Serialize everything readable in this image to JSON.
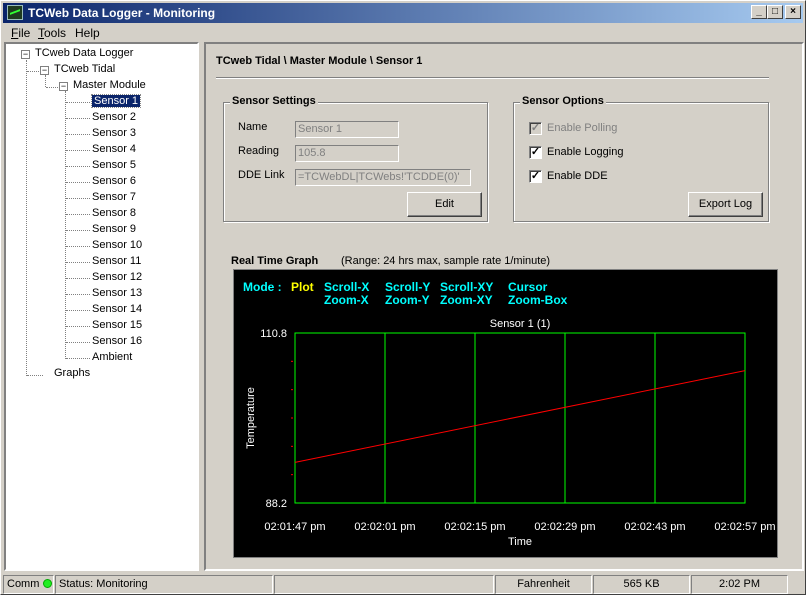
{
  "window": {
    "title": "TCWeb Data Logger - Monitoring",
    "min_label": "_",
    "max_label": "□",
    "close_label": "×"
  },
  "menu": {
    "file_first": "F",
    "file_rest": "ile",
    "tools_first": "T",
    "tools_rest": "ools",
    "help": "Help"
  },
  "tree": {
    "root": "TCweb Data Logger",
    "device": "TCweb Tidal",
    "module": "Master Module",
    "sensors": [
      "Sensor 1",
      "Sensor 2",
      "Sensor 3",
      "Sensor 4",
      "Sensor 5",
      "Sensor 6",
      "Sensor 7",
      "Sensor 8",
      "Sensor 9",
      "Sensor 10",
      "Sensor 11",
      "Sensor 12",
      "Sensor 13",
      "Sensor 14",
      "Sensor 15",
      "Sensor 16",
      "Ambient"
    ],
    "graphs": "Graphs",
    "expander_label": "−"
  },
  "main": {
    "breadcrumb": "TCweb Tidal \\ Master Module \\ Sensor 1",
    "settings": {
      "title": "Sensor Settings",
      "name_label": "Name",
      "name_value": "Sensor 1",
      "reading_label": "Reading",
      "reading_value": "105.8",
      "dde_label": "DDE Link",
      "dde_value": "=TCWebDL|TCWebs!'TCDDE(0)'",
      "edit_button": "Edit"
    },
    "options": {
      "title": "Sensor Options",
      "polling_label": "Enable Polling",
      "polling_checked": true,
      "polling_disabled": true,
      "logging_label": "Enable Logging",
      "logging_checked": true,
      "dde_label": "Enable DDE",
      "dde_checked": true,
      "check_mark": "✓",
      "export_button": "Export Log"
    },
    "graph": {
      "title": "Real Time Graph",
      "range": "(Range: 24 hrs max, sample rate 1/minute)",
      "mode_label": "Mode :",
      "modes": [
        {
          "top": "Plot",
          "bottom": "",
          "color": "#ffff00"
        },
        {
          "top": "Scroll-X",
          "bottom": "Zoom-X",
          "color": "#00ffff"
        },
        {
          "top": "Scroll-Y",
          "bottom": "Zoom-Y",
          "color": "#00ffff"
        },
        {
          "top": "Scroll-XY",
          "bottom": "Zoom-XY",
          "color": "#00ffff"
        },
        {
          "top": "Cursor",
          "bottom": "Zoom-Box",
          "color": "#00ffff"
        }
      ]
    }
  },
  "chart_data": {
    "type": "line",
    "title": "Sensor 1  (1)",
    "xlabel": "Time",
    "ylabel": "Temperature",
    "ylim": [
      88.2,
      110.8
    ],
    "y_ticks": [
      "110.8",
      "88.2"
    ],
    "x_ticks": [
      "02:01:47 pm",
      "02:02:01 pm",
      "02:02:15 pm",
      "02:02:29 pm",
      "02:02:43 pm",
      "02:02:57 pm"
    ],
    "x": [
      "02:01:47 pm",
      "02:02:57 pm"
    ],
    "series": [
      {
        "values": [
          93.6,
          105.8
        ],
        "color": "#ff0000"
      }
    ],
    "grid_color": "#00ff00",
    "grid": true
  },
  "status": {
    "comm": "Comm",
    "status": "Status: Monitoring",
    "units": "Fahrenheit",
    "memory": "565 KB",
    "time": "2:02 PM"
  }
}
